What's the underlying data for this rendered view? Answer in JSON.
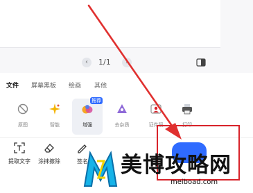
{
  "pager": {
    "prev": "‹",
    "page_indicator": "1/1",
    "next": "›"
  },
  "toolbar": {
    "tabs": [
      {
        "label": "文件",
        "active": true
      },
      {
        "label": "屏幕黑板",
        "active": false
      },
      {
        "label": "绘画",
        "active": false
      },
      {
        "label": "其他",
        "active": false
      }
    ],
    "tools": [
      {
        "label": "原图",
        "icon": "no-filter-icon"
      },
      {
        "label": "智能",
        "icon": "magic-sparkle-icon"
      },
      {
        "label": "增强",
        "icon": "enhance-icon",
        "badge": "推荐",
        "selected": true
      },
      {
        "label": "去杂质",
        "icon": "remove-impurity-icon"
      },
      {
        "label": "证件照",
        "icon": "id-photo-icon"
      },
      {
        "label": "打印",
        "icon": "printer-icon"
      }
    ]
  },
  "bottom_tools": [
    {
      "label": "提取文字",
      "icon": "text-extract-icon"
    },
    {
      "label": "涂抹擦除",
      "icon": "eraser-icon"
    },
    {
      "label": "签名",
      "icon": "signature-icon"
    }
  ],
  "watermark": {
    "title": "美博攻略网",
    "url": "meiboad.com"
  },
  "colors": {
    "accent": "#2f6bff",
    "highlight": "#d8232a"
  }
}
